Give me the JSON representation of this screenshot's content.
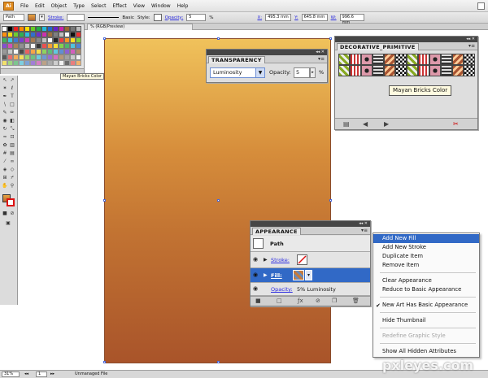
{
  "menubar": {
    "logo": "Ai",
    "items": [
      "File",
      "Edit",
      "Object",
      "Type",
      "Select",
      "Effect",
      "View",
      "Window",
      "Help"
    ]
  },
  "control_bar": {
    "selection": "Path",
    "stroke_label": "Stroke:",
    "brush": "Basic",
    "style_label": "Style:",
    "opacity_label": "Opacity:",
    "opacity_value": "5",
    "opacity_unit": "%",
    "x_label": "X:",
    "x_value": "495.3 mm",
    "y_label": "Y:",
    "y_value": "645.8 mm",
    "w_label": "W:",
    "w_value": "996.6 mm"
  },
  "document_tab": "% (RGB/Preview)",
  "swatch_tooltip": "Mayan Bricks Color",
  "transparency_panel": {
    "title": "TRANSPARENCY",
    "blend_mode": "Luminosity",
    "opacity_label": "Opacity:",
    "opacity_value": "5",
    "opacity_unit": "%"
  },
  "decorative_panel": {
    "title": "DECORATIVE_PRIMITIVE",
    "tooltip": "Mayan Bricks Color"
  },
  "appearance_panel": {
    "title": "APPEARANCE",
    "object": "Path",
    "stroke_label": "Stroke:",
    "fill_label": "Fill:",
    "opacity_label": "Opacity:",
    "opacity_value": "5% Luminosity"
  },
  "context_menu": {
    "items": [
      {
        "label": "Add New Fill",
        "state": "highlighted"
      },
      {
        "label": "Add New Stroke",
        "state": "normal"
      },
      {
        "label": "Duplicate Item",
        "state": "normal"
      },
      {
        "label": "Remove Item",
        "state": "normal"
      },
      {
        "label": "Clear Appearance",
        "state": "normal"
      },
      {
        "label": "Reduce to Basic Appearance",
        "state": "normal"
      },
      {
        "label": "New Art Has Basic Appearance",
        "state": "checked"
      },
      {
        "label": "Hide Thumbnail",
        "state": "normal"
      },
      {
        "label": "Redefine Graphic Style",
        "state": "disabled"
      },
      {
        "label": "Show All Hidden Attributes",
        "state": "normal"
      }
    ]
  },
  "status_bar": {
    "zoom": "31%",
    "artboard": "1",
    "file_state": "Unmanaged File"
  },
  "watermark": "pxleyes.com",
  "colors": {
    "accent": "#3169c6",
    "panel_title_bg": "#464646",
    "canvas_top": "#f0c25b",
    "canvas_bottom": "#a9542a"
  }
}
